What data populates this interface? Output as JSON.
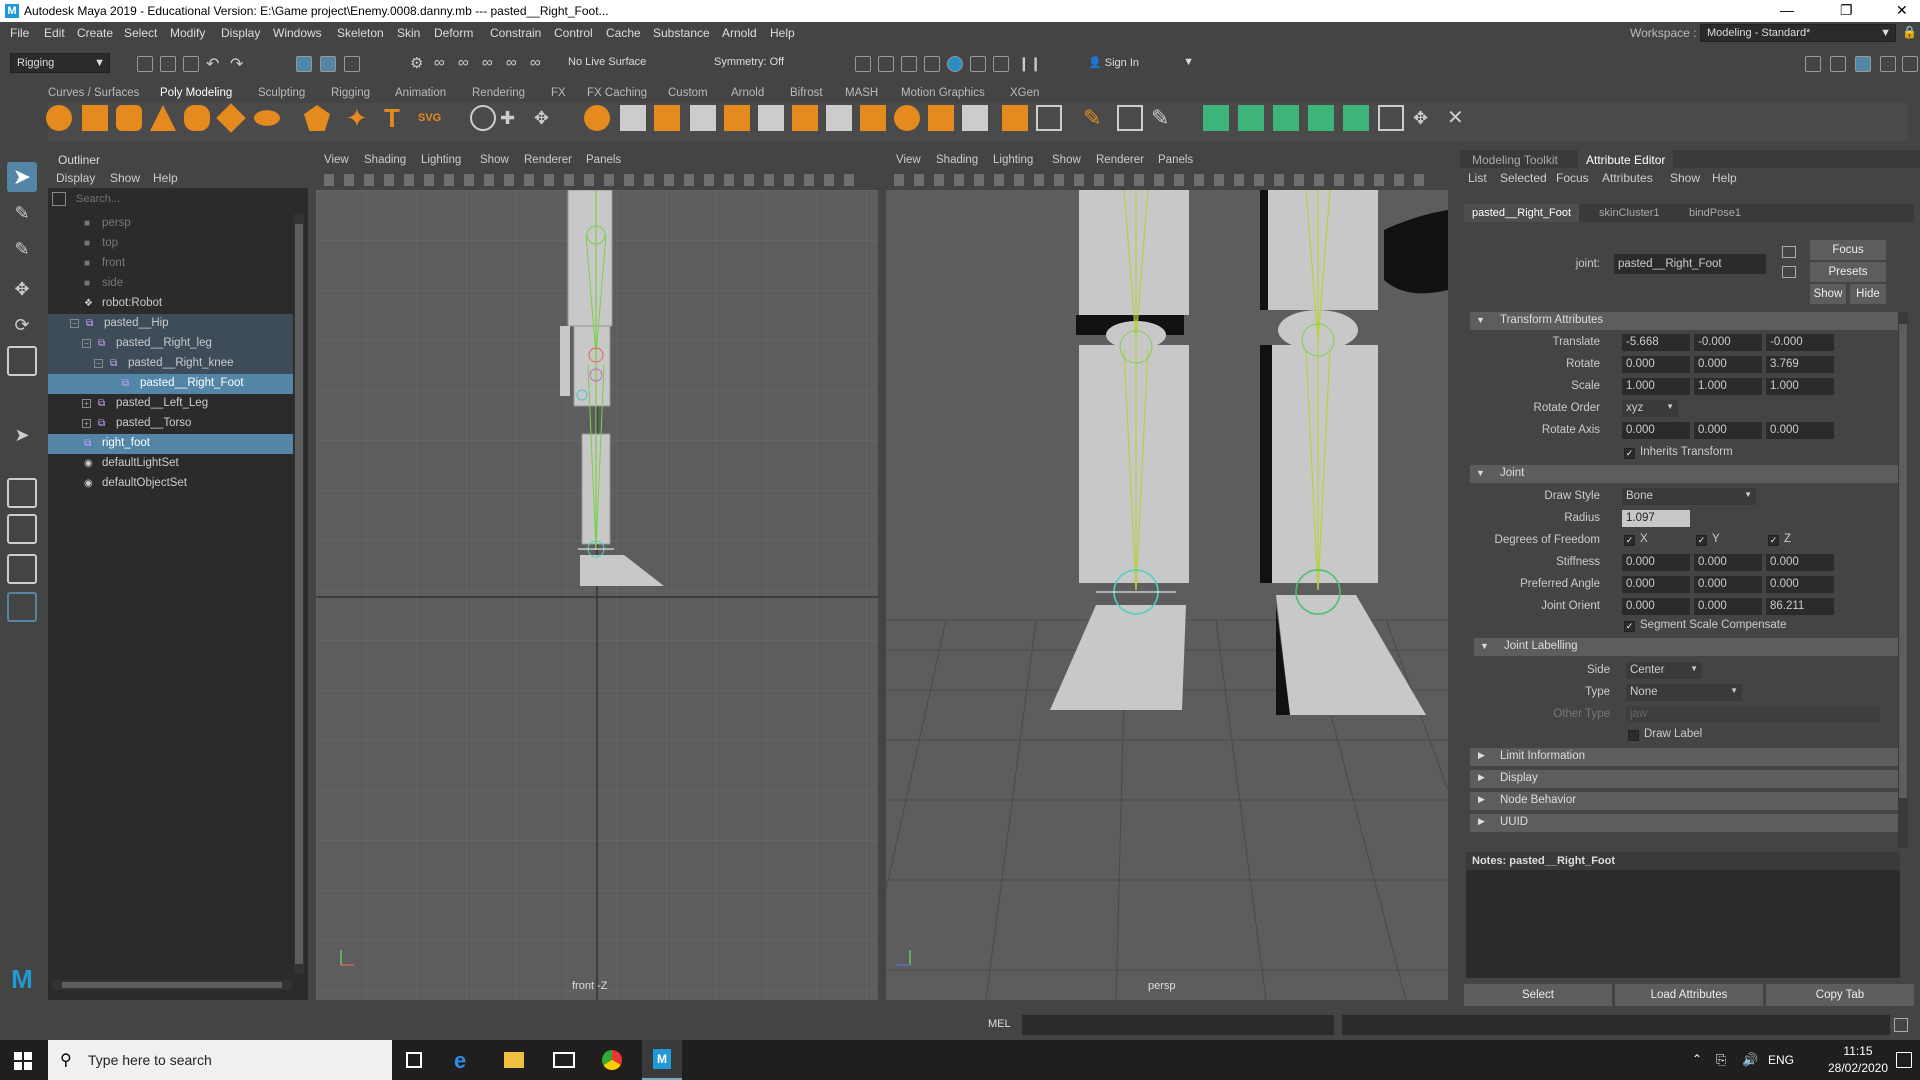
{
  "title": {
    "text": "Autodesk Maya 2019 - Educational Version: E:\\Game project\\Enemy.0008.danny.mb  ---  pasted__Right_Foot..."
  },
  "menu": [
    "File",
    "Edit",
    "Create",
    "Select",
    "Modify",
    "Display",
    "Windows",
    "Skeleton",
    "Skin",
    "Deform",
    "Constrain",
    "Control",
    "Cache",
    "Substance",
    "Arnold",
    "Help"
  ],
  "workspace": {
    "label": "Workspace :",
    "value": "Modeling - Standard*"
  },
  "status": {
    "menuset": "Rigging",
    "live_surface": "No Live Surface",
    "symmetry": "Symmetry: Off",
    "sign_in": "Sign In"
  },
  "shelf_tabs": [
    "Curves / Surfaces",
    "Poly Modeling",
    "Sculpting",
    "Rigging",
    "Animation",
    "Rendering",
    "FX",
    "FX Caching",
    "Custom",
    "Arnold",
    "Bifrost",
    "MASH",
    "Motion Graphics",
    "XGen"
  ],
  "outliner": {
    "title": "Outliner",
    "menu": [
      "Display",
      "Show",
      "Help"
    ],
    "search_placeholder": "Search...",
    "items": [
      "persp",
      "top",
      "front",
      "side",
      "robot:Robot",
      "pasted__Hip",
      "pasted__Right_leg",
      "pasted__Right_knee",
      "pasted__Right_Foot",
      "pasted__Left_Leg",
      "pasted__Torso",
      "right_foot",
      "defaultLightSet",
      "defaultObjectSet"
    ]
  },
  "viewport_menu": [
    "View",
    "Shading",
    "Lighting",
    "Show",
    "Renderer",
    "Panels"
  ],
  "viewport_left_label": "front -Z",
  "viewport_right_label": "persp",
  "ae": {
    "tabs_top": [
      "Modeling Toolkit",
      "Attribute Editor"
    ],
    "menu": [
      "List",
      "Selected",
      "Focus",
      "Attributes",
      "Show",
      "Help"
    ],
    "node_tabs": [
      "pasted__Right_Foot",
      "skinCluster1",
      "bindPose1"
    ],
    "joint_label": "joint:",
    "joint_value": "pasted__Right_Foot",
    "focus": "Focus",
    "presets": "Presets",
    "show": "Show",
    "hide": "Hide",
    "transform_section": "Transform Attributes",
    "translate_label": "Translate",
    "translate": [
      "-5.668",
      "-0.000",
      "-0.000"
    ],
    "rotate_label": "Rotate",
    "rotate": [
      "0.000",
      "0.000",
      "3.769"
    ],
    "scale_label": "Scale",
    "scale": [
      "1.000",
      "1.000",
      "1.000"
    ],
    "rotate_order_label": "Rotate Order",
    "rotate_order": "xyz",
    "rotate_axis_label": "Rotate Axis",
    "rotate_axis": [
      "0.000",
      "0.000",
      "0.000"
    ],
    "inherits": "Inherits Transform",
    "joint_section": "Joint",
    "draw_style_label": "Draw Style",
    "draw_style": "Bone",
    "radius_label": "Radius",
    "radius": "1.097",
    "dof_label": "Degrees of Freedom",
    "dof": [
      "X",
      "Y",
      "Z"
    ],
    "stiffness_label": "Stiffness",
    "stiffness": [
      "0.000",
      "0.000",
      "0.000"
    ],
    "pref_label": "Preferred Angle",
    "pref": [
      "0.000",
      "0.000",
      "0.000"
    ],
    "orient_label": "Joint Orient",
    "orient": [
      "0.000",
      "0.000",
      "86.211"
    ],
    "ssc": "Segment Scale Compensate",
    "labelling_section": "Joint Labelling",
    "side_label": "Side",
    "side": "Center",
    "type_label": "Type",
    "type": "None",
    "other_type_label": "Other Type",
    "other_type": "jaw",
    "draw_label": "Draw Label",
    "collapsed": [
      "Limit Information",
      "Display",
      "Node Behavior",
      "UUID"
    ],
    "notes": "Notes:  pasted__Right_Foot",
    "select": "Select",
    "load": "Load Attributes",
    "copy": "Copy Tab"
  },
  "cmd": {
    "label": "MEL"
  },
  "taskbar": {
    "search": "Type here to search",
    "lang": "ENG",
    "time": "11:15",
    "date": "28/02/2020"
  }
}
